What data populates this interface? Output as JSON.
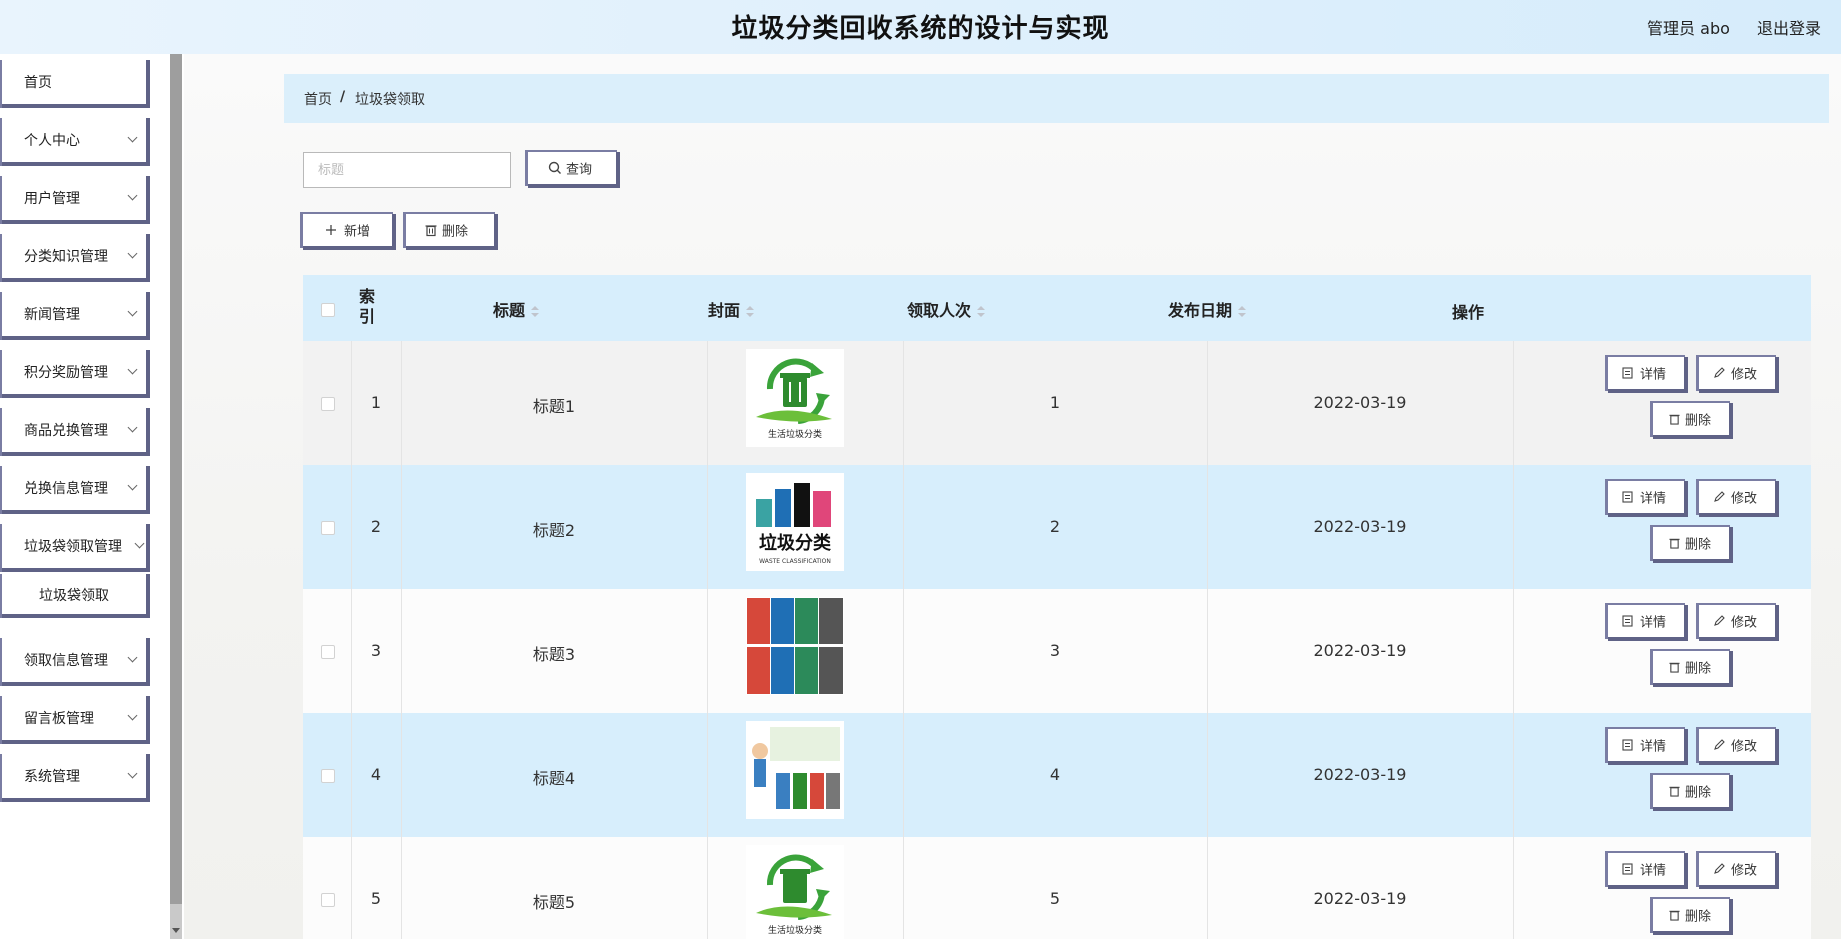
{
  "header": {
    "title": "垃圾分类回收系统的设计与实现",
    "user": "管理员 abo",
    "logout": "退出登录"
  },
  "sidebar": {
    "items": [
      {
        "label": "首页"
      },
      {
        "label": "个人中心"
      },
      {
        "label": "用户管理"
      },
      {
        "label": "分类知识管理"
      },
      {
        "label": "新闻管理"
      },
      {
        "label": "积分奖励管理"
      },
      {
        "label": "商品兑换管理"
      },
      {
        "label": "兑换信息管理"
      },
      {
        "label": "垃圾袋领取管理"
      },
      {
        "label": "垃圾袋领取"
      },
      {
        "label": "领取信息管理"
      },
      {
        "label": "留言板管理"
      },
      {
        "label": "系统管理"
      }
    ]
  },
  "breadcrumb": {
    "home": "首页",
    "sep": "/",
    "current": "垃圾袋领取"
  },
  "search": {
    "placeholder": "标题",
    "button": "查询"
  },
  "toolbar": {
    "add": "新增",
    "delete": "删除"
  },
  "table": {
    "columns": {
      "index": "索\n引",
      "title": "标题",
      "cover": "封面",
      "count": "领取人次",
      "date": "发布日期",
      "ops": "操作"
    },
    "rows": [
      {
        "index": "1",
        "title": "标题1",
        "count": "1",
        "date": "2022-03-19",
        "cover": "recycle-bin-logo",
        "cover_text": "生活垃圾分类"
      },
      {
        "index": "2",
        "title": "标题2",
        "count": "2",
        "date": "2022-03-19",
        "cover": "waste-classification-bins",
        "cover_text": "垃圾分类",
        "cover_sub": "WASTE CLASSIFICATION"
      },
      {
        "index": "3",
        "title": "标题3",
        "count": "3",
        "date": "2022-03-19",
        "cover": "sorting-sign-grid"
      },
      {
        "index": "4",
        "title": "标题4",
        "count": "4",
        "date": "2022-03-19",
        "cover": "child-with-bins"
      },
      {
        "index": "5",
        "title": "标题5",
        "count": "5",
        "date": "2022-03-19",
        "cover": "recycle-bin-logo",
        "cover_text": "生活垃圾分类"
      }
    ],
    "actions": {
      "detail": "详情",
      "edit": "修改",
      "delete": "删除"
    }
  },
  "colors": {
    "accent": "#5f6286",
    "header_bg": "#dcefff",
    "row_highlight": "#d7eefc",
    "recycle_green": "#3aa33a"
  }
}
